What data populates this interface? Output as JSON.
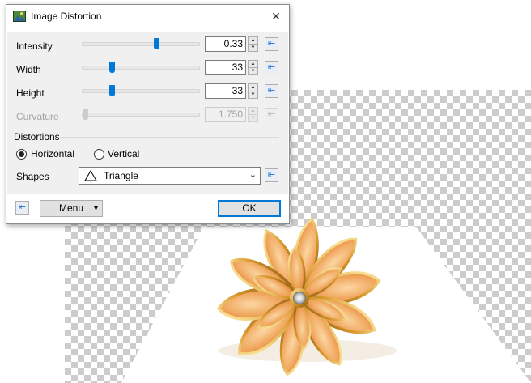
{
  "dialog": {
    "title": "Image Distortion",
    "close_label": "✕"
  },
  "controls": {
    "intensity": {
      "label": "Intensity",
      "value": "0.33",
      "slider_fraction": 0.67
    },
    "width": {
      "label": "Width",
      "value": "33",
      "slider_fraction": 0.27
    },
    "height": {
      "label": "Height",
      "value": "33",
      "slider_fraction": 0.27
    },
    "curvature": {
      "label": "Curvature",
      "value": "1.750",
      "slider_fraction": 0.0,
      "disabled": true
    }
  },
  "distortions": {
    "group_label": "Distortions",
    "options": [
      {
        "label": "Horizontal",
        "selected": true
      },
      {
        "label": "Vertical",
        "selected": false
      }
    ]
  },
  "shapes": {
    "label": "Shapes",
    "selected": "Triangle",
    "icon": "triangle-icon"
  },
  "footer": {
    "menu_label": "Menu",
    "ok_label": "OK"
  },
  "icons": {
    "reset": "reset-arrow-icon",
    "spin_up": "▲",
    "spin_down": "▼",
    "reset_glyph": "⇤",
    "menu_chevron": "▾",
    "combo_chevron": "⌄"
  },
  "colors": {
    "accent": "#0078d7",
    "dialog_body": "#f0f0f0",
    "checker": "#cccccc"
  }
}
